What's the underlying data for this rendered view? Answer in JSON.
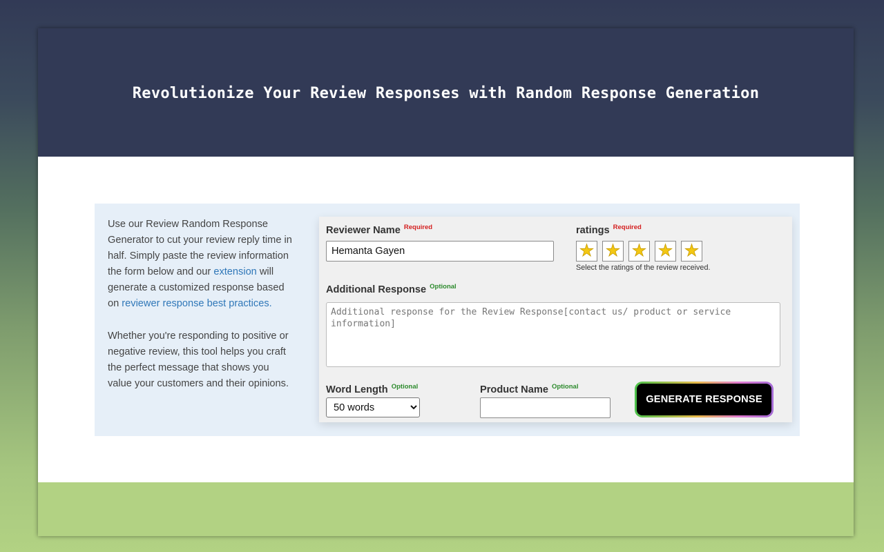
{
  "hero": {
    "title": "Revolutionize Your Review Responses with Random Response Generation"
  },
  "intro": {
    "p1_before_extension": "Use our Review Random Response Generator to cut your review reply time in half.  Simply paste the review information the form below and our ",
    "extension_link": "extension",
    "p1_middle": " will generate a customized response based on ",
    "best_practices_link": "reviewer response best practices.",
    "p2": "Whether you're responding to positive or negative review, this tool helps you craft the perfect message that shows you value your customers and their opinions."
  },
  "form": {
    "reviewer_name": {
      "label": "Reviewer Name",
      "tag": "Required",
      "value": "Hemanta Gayen"
    },
    "ratings": {
      "label": "ratings",
      "tag": "Required",
      "stars": [
        "★",
        "★",
        "★",
        "★",
        "★"
      ],
      "star_icon": "star-icon",
      "star_color": "#f3c713",
      "hint": "Select the ratings of the review received."
    },
    "additional_response": {
      "label": "Additional Response",
      "tag": "Optional",
      "placeholder": "Additional response for the Review Response[contact us/ product or service information]"
    },
    "word_length": {
      "label": "Word Length",
      "tag": "Optional",
      "selected": "50 words"
    },
    "product_name": {
      "label": "Product Name",
      "tag": "Optional",
      "value": ""
    },
    "generate_button": "GENERATE RESPONSE"
  },
  "colors": {
    "header_bg": "#323a56",
    "footer_band": "#b2d283",
    "panel_bg": "#e6eff8",
    "link": "#2f77b8",
    "required": "#d42020",
    "optional": "#2c8a2c"
  }
}
